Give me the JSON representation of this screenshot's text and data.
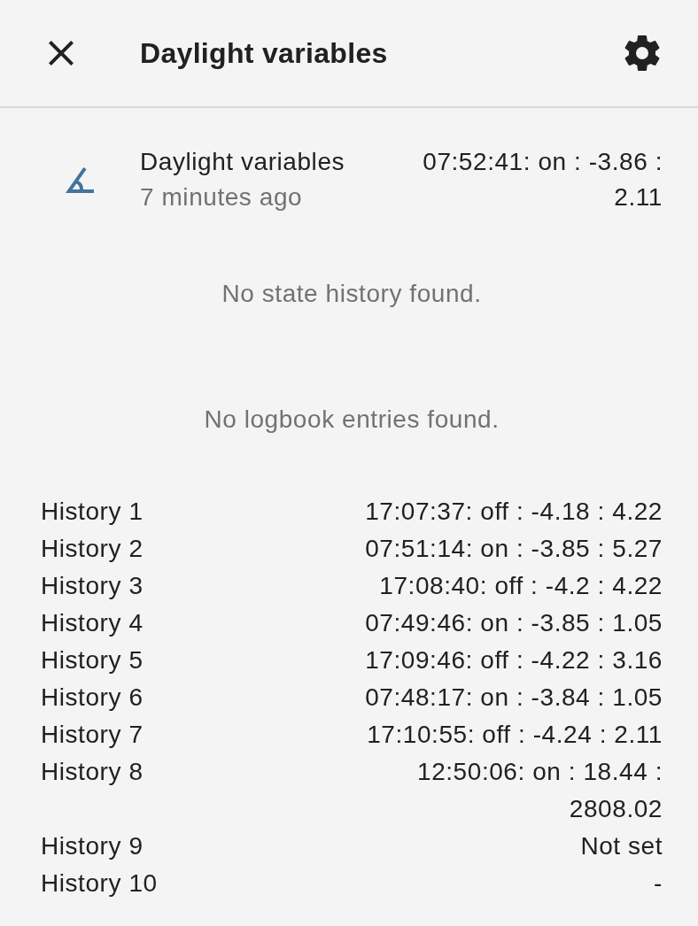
{
  "header": {
    "title": "Daylight variables"
  },
  "entity": {
    "name": "Daylight variables",
    "last_changed": "7 minutes ago",
    "state": "07:52:41: on : -3.86 : 2.11"
  },
  "history_message": "No state history found.",
  "logbook_message": "No logbook entries found.",
  "attributes": [
    {
      "label": "History 1",
      "value": "17:07:37: off : -4.18 : 4.22"
    },
    {
      "label": "History 2",
      "value": "07:51:14: on : -3.85 : 5.27"
    },
    {
      "label": "History 3",
      "value": "17:08:40: off : -4.2 : 4.22"
    },
    {
      "label": "History 4",
      "value": "07:49:46: on : -3.85 : 1.05"
    },
    {
      "label": "History 5",
      "value": "17:09:46: off : -4.22 : 3.16"
    },
    {
      "label": "History 6",
      "value": "07:48:17: on : -3.84 : 1.05"
    },
    {
      "label": "History 7",
      "value": "17:10:55: off : -4.24 : 2.11"
    },
    {
      "label": "History 8",
      "value": "12:50:06: on : 18.44 : 2808.02"
    },
    {
      "label": "History 9",
      "value": "Not set"
    },
    {
      "label": "History 10",
      "value": "-"
    }
  ]
}
